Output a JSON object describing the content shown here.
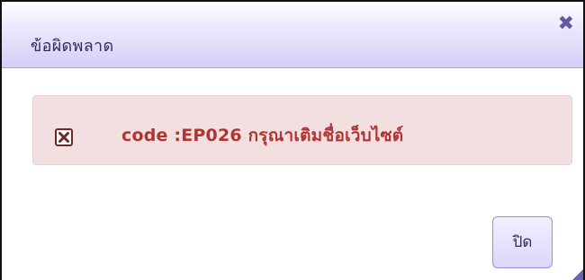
{
  "dialog": {
    "title": "ข้อผิดพลาด",
    "close_icon_glyph": "✖",
    "error": {
      "icon": "error-x-icon",
      "message": "code :EP026 กรุณาเติมชื่อเว็บไซต์"
    },
    "close_button_label": "ปิด"
  },
  "colors": {
    "titlebar_accent": "#d6cdf8",
    "error_background": "#f2dfdf",
    "error_text": "#b13434"
  }
}
